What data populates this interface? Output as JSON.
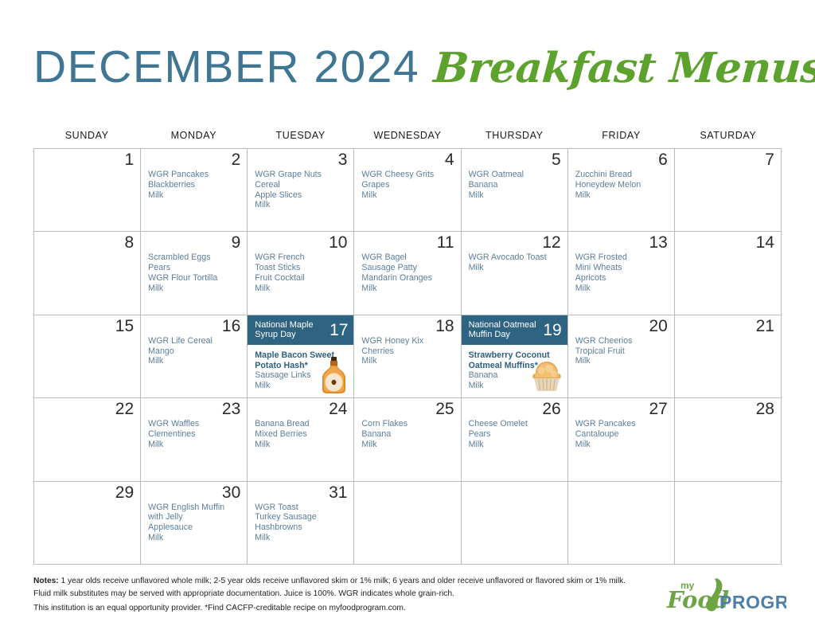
{
  "title": {
    "month_year": "DECEMBER 2024",
    "script": "Breakfast Menus",
    "color_month": "#3E7694",
    "color_script": "#5EA22E"
  },
  "weekdays": [
    "SUNDAY",
    "MONDAY",
    "TUESDAY",
    "WEDNESDAY",
    "THURSDAY",
    "FRIDAY",
    "SATURDAY"
  ],
  "theme": {
    "highlight_bg": "#2E6382",
    "menu_text": "#5B7D9B",
    "grid_line": "#b9bcbe"
  },
  "cells": [
    {
      "day": "1",
      "items": []
    },
    {
      "day": "2",
      "items": [
        "WGR Pancakes",
        "Blackberries",
        "Milk"
      ]
    },
    {
      "day": "3",
      "items": [
        "WGR Grape Nuts Cereal",
        "Apple Slices",
        "Milk"
      ]
    },
    {
      "day": "4",
      "items": [
        "WGR Cheesy Grits",
        "Grapes",
        "Milk"
      ]
    },
    {
      "day": "5",
      "items": [
        "WGR Oatmeal",
        "Banana",
        "Milk"
      ]
    },
    {
      "day": "6",
      "items": [
        "Zucchini Bread",
        "Honeydew Melon",
        "Milk"
      ]
    },
    {
      "day": "7",
      "items": []
    },
    {
      "day": "8",
      "items": []
    },
    {
      "day": "9",
      "items": [
        "Scrambled Eggs",
        "Pears",
        "WGR Flour Tortilla",
        "Milk"
      ]
    },
    {
      "day": "10",
      "items": [
        "WGR French",
        "Toast Sticks",
        "Fruit Cocktail",
        "Milk"
      ]
    },
    {
      "day": "11",
      "items": [
        "WGR Bagel",
        "Sausage Patty",
        "Mandarin Oranges",
        "Milk"
      ]
    },
    {
      "day": "12",
      "items": [
        "WGR Avocado Toast",
        "Milk"
      ]
    },
    {
      "day": "13",
      "items": [
        "WGR Frosted",
        "Mini Wheats",
        "Apricots",
        "Milk"
      ]
    },
    {
      "day": "14",
      "items": []
    },
    {
      "day": "15",
      "items": []
    },
    {
      "day": "16",
      "items": [
        "WGR Life Cereal",
        "Mango",
        "Milk"
      ]
    },
    {
      "day": "17",
      "special": "National Maple Syrup Day",
      "icon": "maple-syrup-bottle-icon",
      "bold_items": [
        "Maple Bacon Sweet",
        "Potato Hash*"
      ],
      "items": [
        "Sausage Links",
        "Milk"
      ]
    },
    {
      "day": "18",
      "items": [
        "WGR Honey Kix",
        "Cherries",
        "Milk"
      ]
    },
    {
      "day": "19",
      "special": "National Oatmeal Muffin Day",
      "icon": "muffin-icon",
      "bold_items": [
        "Strawberry Coconut",
        "Oatmeal Muffins*"
      ],
      "items": [
        "Banana",
        "Milk"
      ]
    },
    {
      "day": "20",
      "items": [
        "WGR Cheerios",
        "Tropical Fruit",
        "Milk"
      ]
    },
    {
      "day": "21",
      "items": []
    },
    {
      "day": "22",
      "items": []
    },
    {
      "day": "23",
      "items": [
        "WGR Waffles",
        "Clementines",
        "Milk"
      ]
    },
    {
      "day": "24",
      "items": [
        "Banana Bread",
        "Mixed Berries",
        "Milk"
      ]
    },
    {
      "day": "25",
      "items": [
        "Corn Flakes",
        "Banana",
        "Milk"
      ]
    },
    {
      "day": "26",
      "items": [
        "Cheese Omelet",
        "Pears",
        "Milk"
      ]
    },
    {
      "day": "27",
      "items": [
        "WGR Pancakes",
        "Cantaloupe",
        "Milk"
      ]
    },
    {
      "day": "28",
      "items": []
    },
    {
      "day": "29",
      "items": []
    },
    {
      "day": "30",
      "items": [
        "WGR English Muffin",
        "with Jelly",
        "Applesauce",
        "Milk"
      ]
    },
    {
      "day": "31",
      "items": [
        "WGR Toast",
        "Turkey Sausage",
        "Hashbrowns",
        "Milk"
      ]
    },
    {
      "day": "",
      "items": []
    },
    {
      "day": "",
      "items": []
    },
    {
      "day": "",
      "items": []
    },
    {
      "day": "",
      "items": []
    }
  ],
  "notes": {
    "label": "Notes:",
    "line1": " 1 year olds receive unflavored whole milk; 2-5 year olds receive unflavored skim or 1% milk; 6 years and older receive unflavored or flavored skim or 1% milk. Fluid milk substitutes may be served with appropriate documentation. Juice is 100%. WGR indicates whole grain-rich.",
    "line2": "This institution is an equal opportunity provider. *Find CACFP-creditable recipe on myfoodprogram.com."
  },
  "logo": {
    "my": "my",
    "food": "Food",
    "program": "PROGRAM",
    "color_green": "#6DA544",
    "color_blue": "#4E7FA8"
  }
}
